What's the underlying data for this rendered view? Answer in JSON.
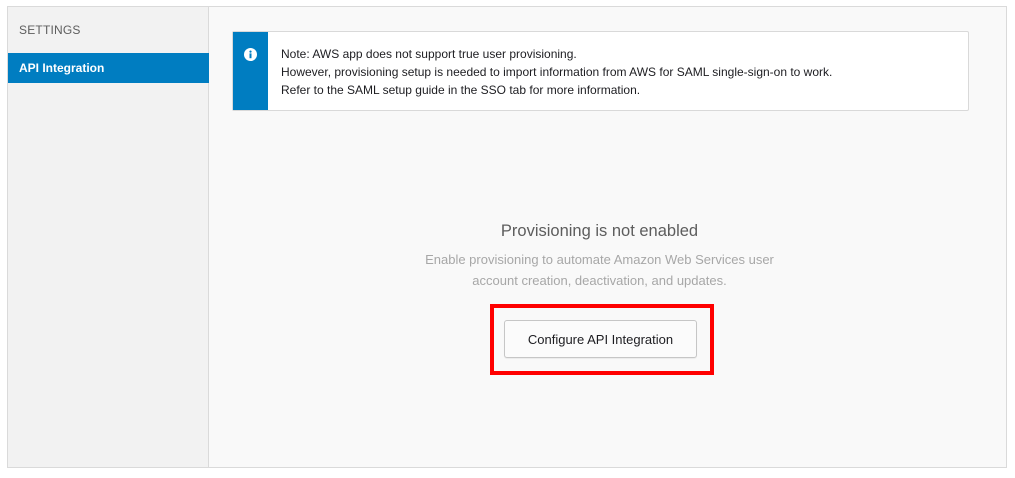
{
  "sidebar": {
    "heading": "SETTINGS",
    "items": [
      {
        "label": "API Integration",
        "active": true
      }
    ]
  },
  "notice": {
    "icon": "info-icon",
    "lines": [
      "Note: AWS app does not support true user provisioning.",
      "However, provisioning setup is needed to import information from AWS for SAML single-sign-on to work.",
      "Refer to the SAML setup guide in the SSO tab for more information."
    ]
  },
  "empty_state": {
    "title": "Provisioning is not enabled",
    "description_lines": [
      "Enable provisioning to automate Amazon Web Services user",
      "account creation, deactivation, and updates."
    ],
    "button_label": "Configure API Integration"
  },
  "colors": {
    "accent": "#007dc1",
    "highlight": "#ff0000"
  }
}
